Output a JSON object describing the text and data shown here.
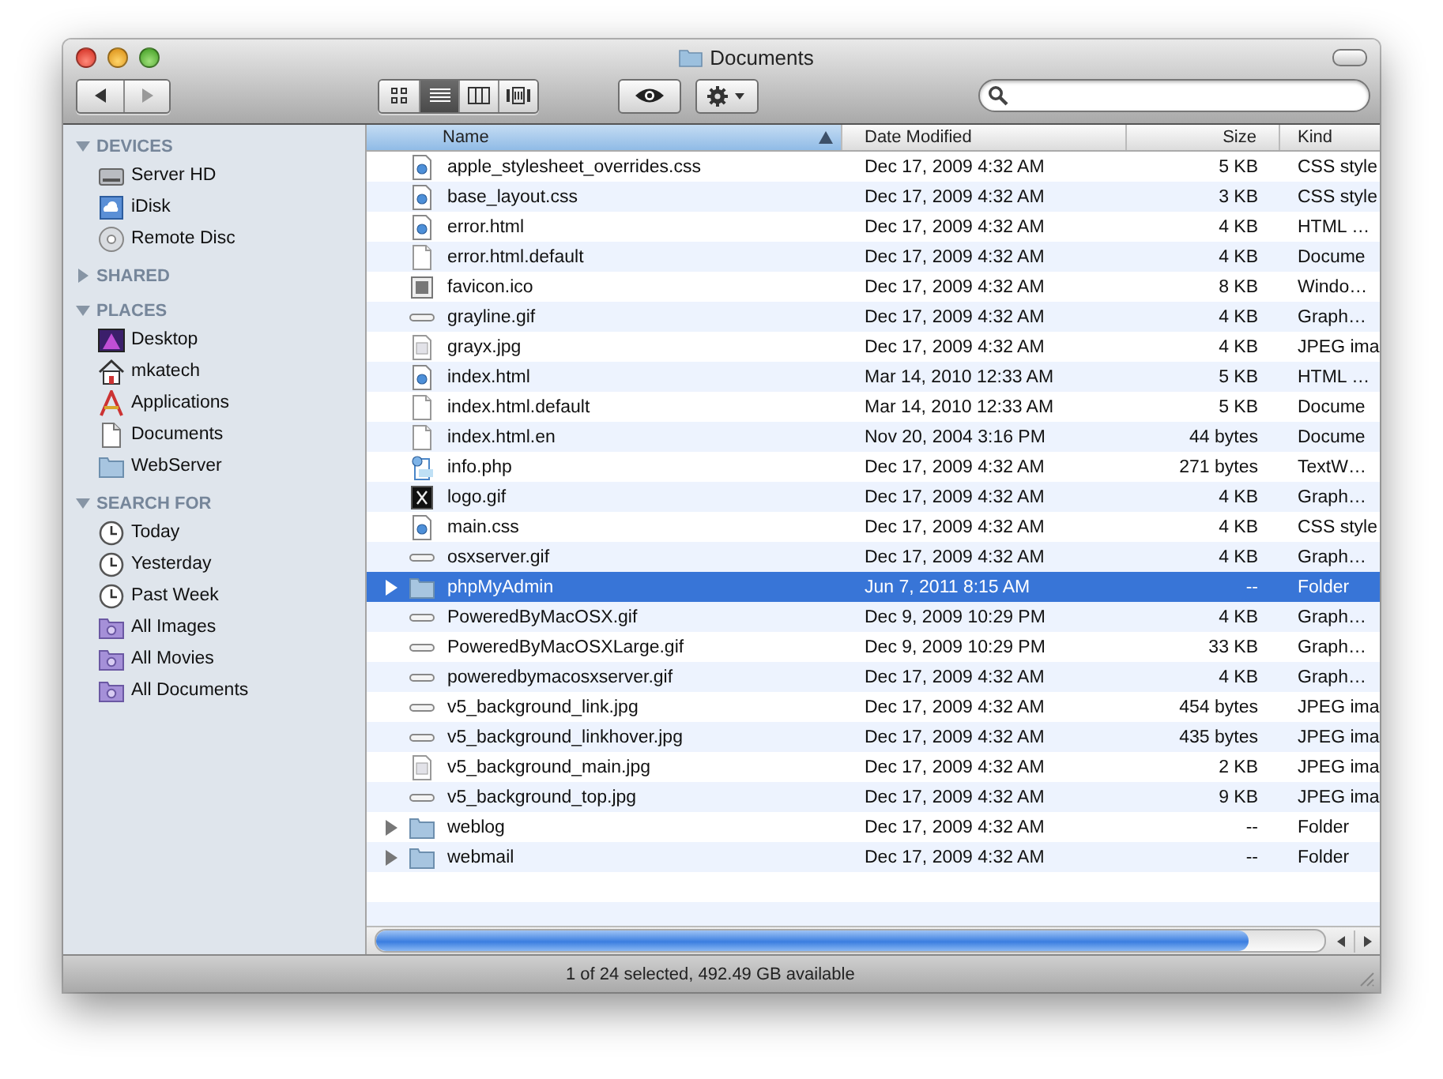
{
  "window": {
    "title": "Documents"
  },
  "toolbar": {
    "view_modes": [
      {
        "kind": "icons",
        "selected": false
      },
      {
        "kind": "list",
        "selected": true
      },
      {
        "kind": "columns",
        "selected": false
      },
      {
        "kind": "coverflow",
        "selected": false
      }
    ]
  },
  "sidebar": {
    "sections": [
      {
        "title": "DEVICES",
        "expanded": true,
        "items": [
          {
            "label": "Server HD",
            "kind": "disk"
          },
          {
            "label": "iDisk",
            "kind": "idisk"
          },
          {
            "label": "Remote Disc",
            "kind": "disc"
          }
        ]
      },
      {
        "title": "SHARED",
        "expanded": false
      },
      {
        "title": "PLACES",
        "expanded": true,
        "items": [
          {
            "label": "Desktop",
            "kind": "desktop"
          },
          {
            "label": "mkatech",
            "kind": "home"
          },
          {
            "label": "Applications",
            "kind": "apps"
          },
          {
            "label": "Documents",
            "kind": "docs"
          },
          {
            "label": "WebServer",
            "kind": "folder"
          }
        ]
      },
      {
        "title": "SEARCH FOR",
        "expanded": true,
        "items": [
          {
            "label": "Today",
            "kind": "clock"
          },
          {
            "label": "Yesterday",
            "kind": "clock"
          },
          {
            "label": "Past Week",
            "kind": "clock"
          },
          {
            "label": "All Images",
            "kind": "smart"
          },
          {
            "label": "All Movies",
            "kind": "smart"
          },
          {
            "label": "All Documents",
            "kind": "smart"
          }
        ]
      }
    ]
  },
  "table": {
    "columns": [
      {
        "label": "Name",
        "sorted": true
      },
      {
        "label": "Date Modified",
        "sorted": false
      },
      {
        "label": "Size",
        "sorted": false
      },
      {
        "label": "Kind",
        "sorted": false
      }
    ],
    "rows": [
      {
        "name": "apple_stylesheet_overrides.css",
        "date": "Dec 17, 2009 4:32 AM",
        "size": "5 KB",
        "file_kind": "CSS style",
        "kind": "web",
        "selected": false
      },
      {
        "name": "base_layout.css",
        "date": "Dec 17, 2009 4:32 AM",
        "size": "3 KB",
        "file_kind": "CSS style",
        "kind": "web",
        "selected": false
      },
      {
        "name": "error.html",
        "date": "Dec 17, 2009 4:32 AM",
        "size": "4 KB",
        "file_kind": "HTML …",
        "kind": "web",
        "selected": false
      },
      {
        "name": "error.html.default",
        "date": "Dec 17, 2009 4:32 AM",
        "size": "4 KB",
        "file_kind": "Docume",
        "kind": "doc",
        "selected": false
      },
      {
        "name": "favicon.ico",
        "date": "Dec 17, 2009 4:32 AM",
        "size": "8 KB",
        "file_kind": "Windo…",
        "kind": "ico",
        "selected": false
      },
      {
        "name": "grayline.gif",
        "date": "Dec 17, 2009 4:32 AM",
        "size": "4 KB",
        "file_kind": "Graph…",
        "kind": "strip",
        "selected": false
      },
      {
        "name": "grayx.jpg",
        "date": "Dec 17, 2009 4:32 AM",
        "size": "4 KB",
        "file_kind": "JPEG ima",
        "kind": "image",
        "selected": false
      },
      {
        "name": "index.html",
        "date": "Mar 14, 2010 12:33 AM",
        "size": "5 KB",
        "file_kind": "HTML …",
        "kind": "web",
        "selected": false
      },
      {
        "name": "index.html.default",
        "date": "Mar 14, 2010 12:33 AM",
        "size": "5 KB",
        "file_kind": "Docume",
        "kind": "doc",
        "selected": false
      },
      {
        "name": "index.html.en",
        "date": "Nov 20, 2004 3:16 PM",
        "size": "44 bytes",
        "file_kind": "Docume",
        "kind": "doc",
        "selected": false
      },
      {
        "name": "info.php",
        "date": "Dec 17, 2009 4:32 AM",
        "size": "271 bytes",
        "file_kind": "TextW…",
        "kind": "php",
        "selected": false
      },
      {
        "name": "logo.gif",
        "date": "Dec 17, 2009 4:32 AM",
        "size": "4 KB",
        "file_kind": "Graph…",
        "kind": "logo",
        "selected": false
      },
      {
        "name": "main.css",
        "date": "Dec 17, 2009 4:32 AM",
        "size": "4 KB",
        "file_kind": "CSS style",
        "kind": "web",
        "selected": false
      },
      {
        "name": "osxserver.gif",
        "date": "Dec 17, 2009 4:32 AM",
        "size": "4 KB",
        "file_kind": "Graph…",
        "kind": "strip",
        "selected": false
      },
      {
        "name": "phpMyAdmin",
        "date": "Jun 7, 2011 8:15 AM",
        "size": "--",
        "file_kind": "Folder",
        "kind": "folder",
        "selected": true
      },
      {
        "name": "PoweredByMacOSX.gif",
        "date": "Dec 9, 2009 10:29 PM",
        "size": "4 KB",
        "file_kind": "Graph…",
        "kind": "strip",
        "selected": false
      },
      {
        "name": "PoweredByMacOSXLarge.gif",
        "date": "Dec 9, 2009 10:29 PM",
        "size": "33 KB",
        "file_kind": "Graph…",
        "kind": "strip",
        "selected": false
      },
      {
        "name": "poweredbymacosxserver.gif",
        "date": "Dec 17, 2009 4:32 AM",
        "size": "4 KB",
        "file_kind": "Graph…",
        "kind": "strip",
        "selected": false
      },
      {
        "name": "v5_background_link.jpg",
        "date": "Dec 17, 2009 4:32 AM",
        "size": "454 bytes",
        "file_kind": "JPEG ima",
        "kind": "strip",
        "selected": false
      },
      {
        "name": "v5_background_linkhover.jpg",
        "date": "Dec 17, 2009 4:32 AM",
        "size": "435 bytes",
        "file_kind": "JPEG ima",
        "kind": "strip",
        "selected": false
      },
      {
        "name": "v5_background_main.jpg",
        "date": "Dec 17, 2009 4:32 AM",
        "size": "2 KB",
        "file_kind": "JPEG ima",
        "kind": "image",
        "selected": false
      },
      {
        "name": "v5_background_top.jpg",
        "date": "Dec 17, 2009 4:32 AM",
        "size": "9 KB",
        "file_kind": "JPEG ima",
        "kind": "strip",
        "selected": false
      },
      {
        "name": "weblog",
        "date": "Dec 17, 2009 4:32 AM",
        "size": "--",
        "file_kind": "Folder",
        "kind": "folder",
        "selected": false
      },
      {
        "name": "webmail",
        "date": "Dec 17, 2009 4:32 AM",
        "size": "--",
        "file_kind": "Folder",
        "kind": "folder",
        "selected": false
      }
    ]
  },
  "status_bar": "1 of 24 selected, 492.49 GB available"
}
